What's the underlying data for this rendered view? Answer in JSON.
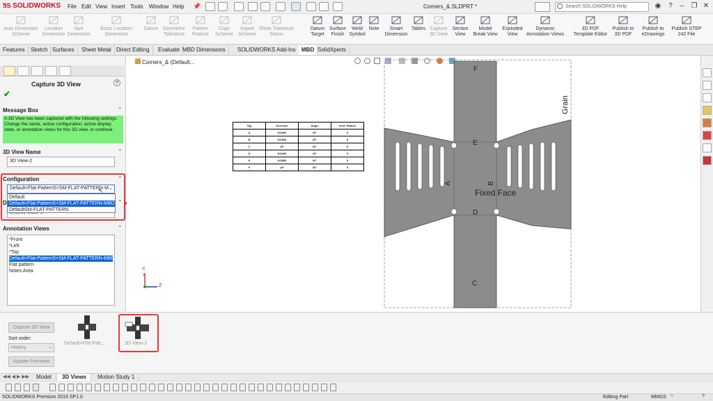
{
  "app": {
    "logo_text": "SOLIDWORKS",
    "doc_title": "Corners_&.SLDPRT *",
    "search_placeholder": "Search SOLIDWORKS Help"
  },
  "menu": [
    "File",
    "Edit",
    "View",
    "Insert",
    "Tools",
    "Window",
    "Help"
  ],
  "ribbon_disabled": [
    {
      "label": "Auto Dimension\nScheme",
      "icon": "auto-dimension-icon"
    },
    {
      "label": "Location\nDimension",
      "icon": "location-dimension-icon"
    },
    {
      "label": "Size\nDimension",
      "icon": "size-dimension-icon"
    },
    {
      "label": "Basic Location Dimension",
      "icon": "basic-location-icon"
    },
    {
      "label": "Datum",
      "icon": "datum-icon"
    },
    {
      "label": "Geometric\nTolerance",
      "icon": "geometric-tolerance-icon"
    },
    {
      "label": "Pattern\nFeature",
      "icon": "pattern-feature-icon"
    },
    {
      "label": "Copy\nScheme",
      "icon": "copy-scheme-icon"
    },
    {
      "label": "Import\nScheme",
      "icon": "import-scheme-icon"
    },
    {
      "label": "Show Tolerance\nStatus",
      "icon": "show-tolerance-icon"
    }
  ],
  "ribbon_enabled": [
    {
      "label": "Datum\nTarget",
      "icon": "datum-target-icon"
    },
    {
      "label": "Surface\nFinish",
      "icon": "surface-finish-icon"
    },
    {
      "label": "Weld\nSymbol",
      "icon": "weld-symbol-icon"
    },
    {
      "label": "Note",
      "icon": "note-icon"
    },
    {
      "label": "Smart\nDimension",
      "icon": "smart-dimension-icon"
    },
    {
      "label": "Tables",
      "icon": "tables-icon"
    }
  ],
  "ribbon_views": [
    {
      "label": "Capture\n3D View",
      "icon": "capture-3d-view-icon",
      "disabled": true
    },
    {
      "label": "Section\nView",
      "icon": "section-view-icon"
    },
    {
      "label": "Model\nBreak View",
      "icon": "model-break-view-icon"
    },
    {
      "label": "Exploded\nView",
      "icon": "exploded-view-icon"
    },
    {
      "label": "Dynamic\nAnnotation Views",
      "icon": "dynamic-annotation-icon"
    }
  ],
  "ribbon_publish": [
    {
      "label": "3D PDF\nTemplate Editor",
      "icon": "pdf-template-icon"
    },
    {
      "label": "Publish to\n3D PDF",
      "icon": "publish-3dpdf-icon"
    },
    {
      "label": "Publish to\neDrawings",
      "icon": "publish-edrawings-icon"
    },
    {
      "label": "Publish STEP\n242 File",
      "icon": "publish-step-icon"
    }
  ],
  "cmd_tabs": [
    "Features",
    "Sketch",
    "Surfaces",
    "Sheet Metal",
    "Direct Editing",
    "Evaluate",
    "MBD Dimensions",
    "SOLIDWORKS Add-Ins",
    "MBD",
    "SolidXperts"
  ],
  "cmd_tab_active": "MBD",
  "panel": {
    "title": "Capture 3D View",
    "msg_header": "Message Box",
    "msg_text": "A 3D View has been captured with the following settings. Change the name, active configuration, active display state, or annotation views for this 3D view, or continue.",
    "name_header": "3D View Name",
    "name_value": "3D View-2",
    "config_header": "Configuration",
    "config_value": "Default<Flat-Pattern5>SM-FLAT-PATTERN-M",
    "config_options": [
      "Default",
      "Default<Flat-Pattern5>SM-FLAT-PATTERN-MBD",
      "DefaultSM-FLAT-PATTERN"
    ],
    "config_selected_index": 1,
    "display_header_letter": "D",
    "display_value": "Display State-3",
    "annot_header": "Annotation Views",
    "annot_items": [
      "*Front",
      "*Left",
      "*Top",
      "Default<Flat-Pattern5>SM-FLAT-PATTERN-MBD",
      "Flat pattern",
      "Notes Area"
    ],
    "annot_selected_index": 3
  },
  "canvas": {
    "tree_label": "Corners_& (Default...",
    "grain_label": "Grain",
    "fixed_face_label": "Fixed Face",
    "letters": {
      "F": "F",
      "E": "E",
      "D": "D",
      "C": "C",
      "A": "A",
      "B": "B"
    },
    "bend_table": {
      "headers": [
        "Tag",
        "Direction",
        "Angle",
        "Inner Radius"
      ],
      "rows": [
        [
          "A",
          "DOWN",
          "90°",
          "5"
        ],
        [
          "B",
          "DOWN",
          "90°",
          "5"
        ],
        [
          "C",
          "UP",
          "90°",
          "5"
        ],
        [
          "D",
          "DOWN",
          "90°",
          "5"
        ],
        [
          "E",
          "DOWN",
          "90°",
          "5"
        ],
        [
          "F",
          "UP",
          "90°",
          "5"
        ]
      ]
    },
    "triad": {
      "x": "X",
      "y": "Y",
      "z": "Z"
    }
  },
  "bottom_panel": {
    "capture_btn": "Capture 3D View",
    "sort_label": "Sort order:",
    "sort_value": "History",
    "update_btn": "Update Previews",
    "thumbs": [
      {
        "label": "Default<Flat-Patt..."
      },
      {
        "label": "3D View-2"
      }
    ]
  },
  "status_tabs": [
    "Model",
    "3D Views",
    "Motion Study 1"
  ],
  "status_tab_active": "3D Views",
  "statusbar": {
    "left": "SOLIDWORKS Premium 2019 SP1.0",
    "mode": "Editing Part",
    "units": "MMGS"
  },
  "colors": {
    "accent_red": "#e53935",
    "select_blue": "#0a64d8",
    "message_green": "#7cf07a",
    "part_gray": "#8c8c8c"
  }
}
